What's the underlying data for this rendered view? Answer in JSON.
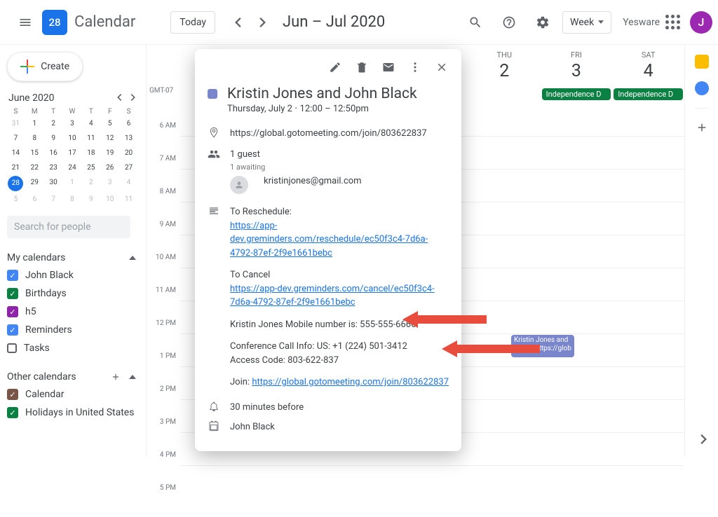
{
  "header": {
    "logo_day": "28",
    "app_title": "Calendar",
    "today": "Today",
    "date_range": "Jun – Jul 2020",
    "view": "Week",
    "brand": "Yesware",
    "avatar_letter": "J"
  },
  "sidebar": {
    "create": "Create",
    "mini_month": "June 2020",
    "dow": [
      "S",
      "M",
      "T",
      "W",
      "T",
      "F",
      "S"
    ],
    "weeks": [
      [
        "31",
        "1",
        "2",
        "3",
        "4",
        "5",
        "6"
      ],
      [
        "7",
        "8",
        "9",
        "10",
        "11",
        "12",
        "13"
      ],
      [
        "14",
        "15",
        "16",
        "17",
        "18",
        "19",
        "20"
      ],
      [
        "21",
        "22",
        "23",
        "24",
        "25",
        "26",
        "27"
      ],
      [
        "28",
        "29",
        "30",
        "1",
        "2",
        "3",
        "4"
      ],
      [
        "5",
        "6",
        "7",
        "8",
        "9",
        "10",
        "11"
      ]
    ],
    "today_cell": "28",
    "search_placeholder": "Search for people",
    "my_calendars_label": "My calendars",
    "my_calendars": [
      {
        "label": "John Black",
        "color": "#4285f4",
        "checked": true
      },
      {
        "label": "Birthdays",
        "color": "#0b8043",
        "checked": true
      },
      {
        "label": "h5",
        "color": "#8e24aa",
        "checked": true
      },
      {
        "label": "Reminders",
        "color": "#4285f4",
        "checked": true
      },
      {
        "label": "Tasks",
        "color": "#5f6368",
        "checked": false
      }
    ],
    "other_calendars_label": "Other calendars",
    "other_calendars": [
      {
        "label": "Calendar",
        "color": "#795548",
        "checked": true
      },
      {
        "label": "Holidays in United States",
        "color": "#0b8043",
        "checked": true
      }
    ]
  },
  "grid": {
    "timezone": "GMT-07",
    "day_headers": [
      {
        "dow": "THU",
        "num": "2"
      },
      {
        "dow": "FRI",
        "num": "3"
      },
      {
        "dow": "SAT",
        "num": "4"
      }
    ],
    "hours": [
      "6 AM",
      "7 AM",
      "8 AM",
      "9 AM",
      "10 AM",
      "11 AM",
      "12 PM",
      "1 PM",
      "2 PM",
      "3 PM",
      "4 PM",
      "5 PM"
    ],
    "allday_chip": "Independence D",
    "event_chip_title": "Kristin Jones and",
    "event_chip_sub": "12pm, https://glob"
  },
  "popup": {
    "title": "Kristin Jones and John Black",
    "datetime": "Thursday, July 2 ⋅ 12:00 – 12:50pm",
    "location": "https://global.gotomeeting.com/join/803622837",
    "guests_count": "1 guest",
    "guests_status": "1 awaiting",
    "guest_email": "kristinjones@gmail.com",
    "desc_reschedule_label": "To Reschedule:",
    "desc_reschedule_link": "https://app-dev.greminders.com/reschedule/ec50f3c4-7d6a-4792-87ef-2f9e1661bebc",
    "desc_cancel_label": "To Cancel",
    "desc_cancel_link": "https://app-dev.greminders.com/cancel/ec50f3c4-7d6a-4792-87ef-2f9e1661bebc",
    "desc_mobile": "Kristin Jones Mobile number is: 555-555-6666",
    "desc_conf": "Conference Call Info: US: +1 (224) 501-3412",
    "desc_access": "Access Code: 803-622-837",
    "desc_join_label": "Join: ",
    "desc_join_link": "https://global.gotomeeting.com/join/803622837",
    "reminder": "30 minutes before",
    "calendar_owner": "John Black"
  }
}
